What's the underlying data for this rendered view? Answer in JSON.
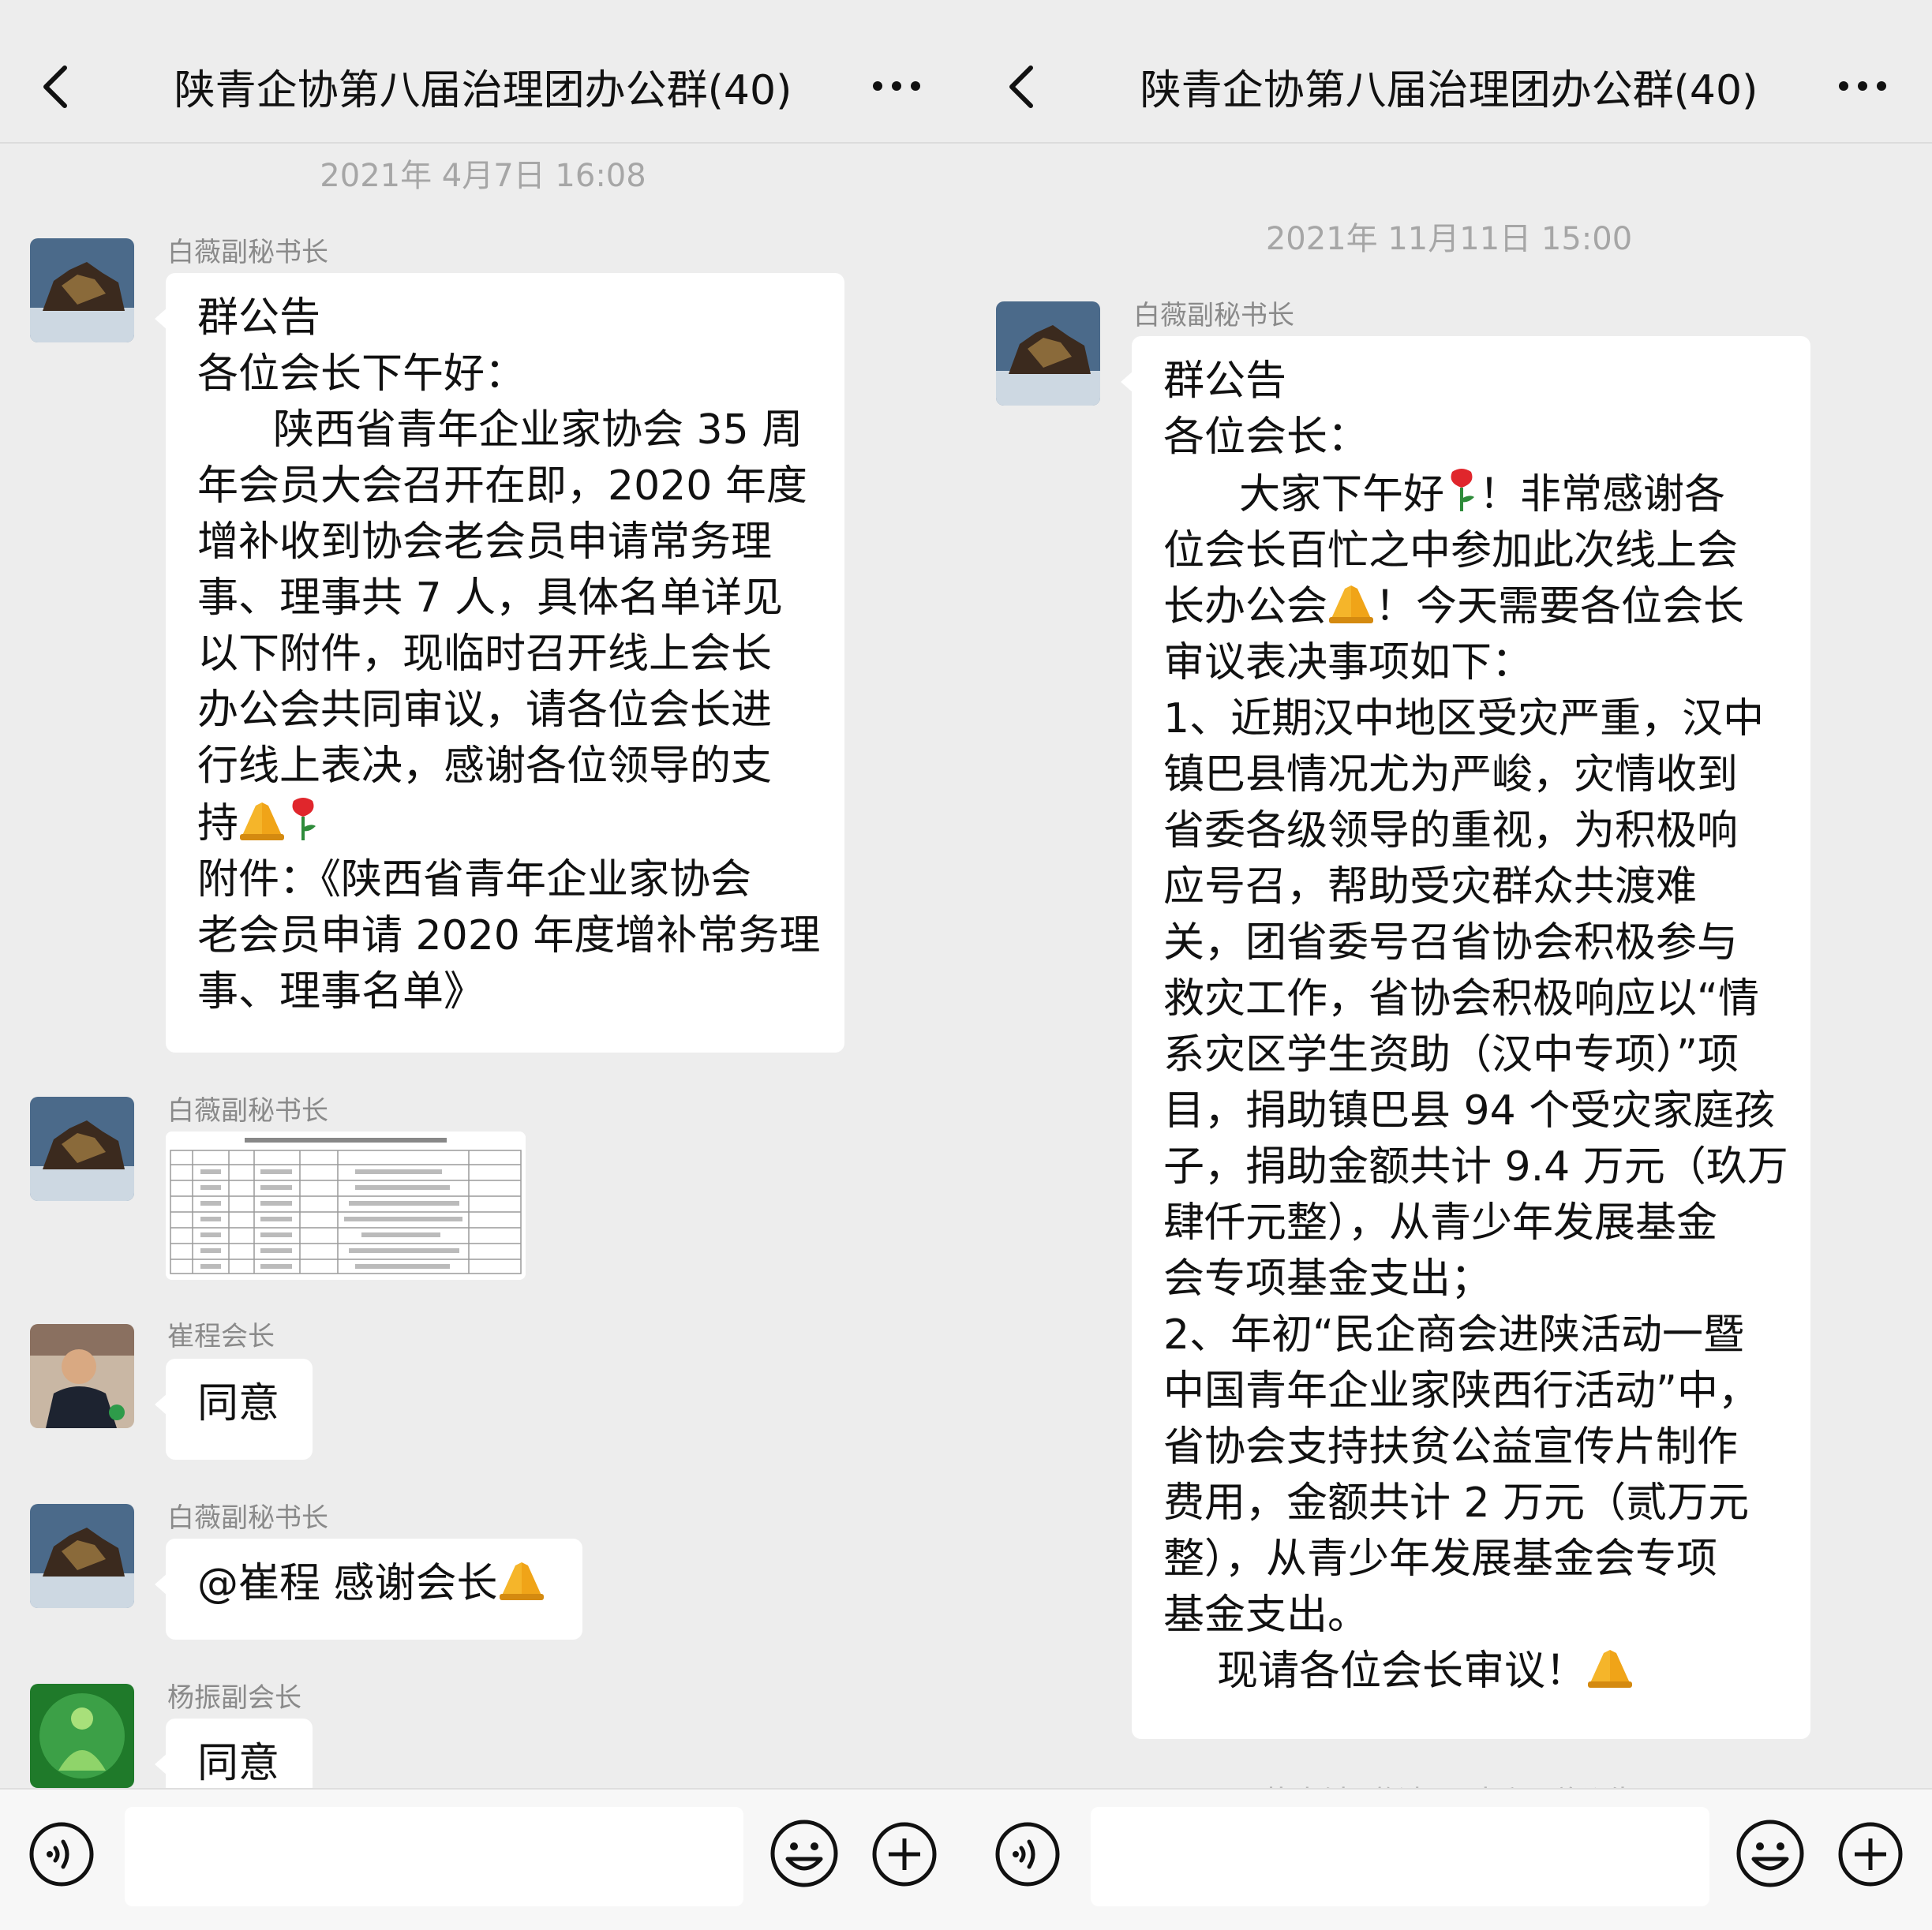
{
  "left": {
    "nav": {
      "title": "陕青企协第八届治理团办公群(40)"
    },
    "timestamp": "2021年 4月7日 16:08",
    "messages": [
      {
        "sender": "白薇副秘书长",
        "lines": [
          "群公告",
          "各位会长下午好：",
          "陕西省青年企业家协会 35 周",
          "年会员大会召开在即，2020 年度",
          "增补收到协会老会员申请常务理",
          "事、理事共 7 人，具体名单详见",
          "以下附件，现临时召开线上会长",
          "办公会共同审议，请各位会长进",
          "行线上表决，感谢各位领导的支",
          "持",
          "附件：《陕西省青年企业家协会",
          "老会员申请 2020 年度增补常务理",
          "事、理事名单》"
        ]
      },
      {
        "sender": "白薇副秘书长"
      },
      {
        "sender": "崔程会长",
        "text": "同意"
      },
      {
        "sender": "白薇副秘书长",
        "text": "@崔程 感谢会长"
      },
      {
        "sender": "杨振副会长",
        "text": "同意"
      }
    ]
  },
  "right": {
    "nav": {
      "title": "陕青企协第八届治理团办公群(40)"
    },
    "timestamp": "2021年 11月11日 15:00",
    "messages": [
      {
        "sender": "白薇副秘书长",
        "lines": [
          "群公告",
          "各位会长：",
          "大家下午好",
          "！非常感谢各",
          "位会长百忙之中参加此次线上会",
          "长办公会",
          "！今天需要各位会长",
          "审议表决事项如下：",
          "1、近期汉中地区受灾严重，汉中",
          "镇巴县情况尤为严峻，灾情收到",
          "省委各级领导的重视，为积极响",
          "应号召，帮助受灾群众共渡难",
          "关，团省委号召省协会积极参与",
          "救灾工作，省协会积极响应以“情",
          "系灾区学生资助（汉中专项）”项",
          "目，捐助镇巴县 94 个受灾家庭孩",
          "子，捐助金额共计 9.4 万元（玖万",
          "肆仟元整），从青少年发展基金",
          "会专项基金支出；",
          "2、年初“民企商会进陕活动一暨",
          "中国青年企业家陕西行活动”中，",
          "省协会支持扶贫公益宣传片制作",
          "费用，金额共计 2 万元（贰万元",
          "整），从青少年发展基金会专项",
          "基金支出。",
          "现请各位会长审议！"
        ]
      }
    ],
    "faded_hint": "黄少波 邀请了 崔程 群公告"
  },
  "icons": [
    "back-icon",
    "more-icon",
    "voice-icon",
    "emoji-icon",
    "plus-icon",
    "pray-emoji",
    "rose-emoji"
  ],
  "colors": {
    "background": "#ededed",
    "bubble": "#ffffff",
    "sender": "#8a8a8a",
    "timestamp": "#a6a6a6"
  }
}
